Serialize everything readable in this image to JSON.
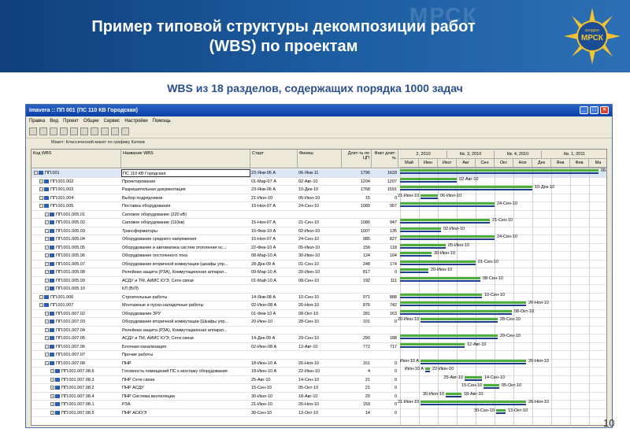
{
  "header": {
    "title_line1": "Пример типовой структуры декомпозиции работ",
    "title_line2": "(WBS) по проектам",
    "watermark": "МРСК",
    "logo_top": "холдинг",
    "logo_text": "МРСК"
  },
  "subtitle": "WBS из 18 разделов, содержащих порядка 1000 задач",
  "page_number": "10",
  "colors": {
    "header": "#1d5ea2",
    "bar_green": "#4caf3a",
    "bar_blue": "#1d3d8c"
  },
  "app": {
    "title": "Imavera :: ПП 001 (ПС 110 КВ Городская)",
    "menu": [
      "Правка",
      "Вид",
      "Проект",
      "Общие",
      "Сервис",
      "Настройки",
      "Помощь"
    ],
    "group_label": "Макет: Классический макет по графику Каткев",
    "columns": {
      "code": "Код WBS",
      "name": "Название WBS",
      "start": "Старт",
      "finish": "Финиш",
      "dur": "Длит-ть по ЦП",
      "fact": "Факт длит-ть"
    },
    "timeline_top": [
      "2, 2010",
      "Кв. 3, 2010",
      "Кв. 4, 2010",
      "Кв. 1, 2011"
    ],
    "timeline_months": [
      "Май",
      "Июн",
      "Июл",
      "Авг",
      "Сен",
      "Окт",
      "Ноя",
      "Дек",
      "Янв",
      "Фев",
      "Ма"
    ],
    "rows": [
      {
        "code": "ПП.001",
        "name": "ПС 110 КВ Городская",
        "start": "23-Янв-06 А",
        "finish": "06-Янв-11",
        "dur": "1796",
        "fact": "1633",
        "lvl": 0,
        "sel": true,
        "g": [
          0,
          252
        ],
        "lr": "06-Янв-11"
      },
      {
        "code": "ПП.001.002",
        "name": "Проектирование",
        "start": "01-Мар-07 А",
        "finish": "02-Авг-10",
        "dur": "1204",
        "fact": "1207",
        "lvl": 1,
        "g": [
          0,
          72
        ],
        "lr": "02-Авг-10"
      },
      {
        "code": "ПП.001.003",
        "name": "Разрешительная документация",
        "start": "23-Янв-06 А",
        "finish": "10-Дек-10",
        "dur": "1768",
        "fact": "1591",
        "lvl": 1,
        "g": [
          0,
          168
        ],
        "lr": "10-Дек-10"
      },
      {
        "code": "ПП.001.004",
        "name": "Выбор подрядчиков",
        "start": "21-Июн-10",
        "finish": "06-Июл-10",
        "dur": "15",
        "fact": "0",
        "lvl": 1,
        "g": [
          26,
          48
        ],
        "ll": "21-Июн-10",
        "lr": "06-Июл-10"
      },
      {
        "code": "ПП.001.005",
        "name": "Поставка оборудования",
        "start": "15-Ноя-07 А",
        "finish": "24-Сен-10",
        "dur": "1089",
        "fact": "957",
        "lvl": 1,
        "g": [
          0,
          120
        ],
        "lr": "24-Сен-10"
      },
      {
        "code": "ПП.001.005.01",
        "name": "Силовое оборудование (220 кВ)",
        "start": "",
        "finish": "",
        "dur": "",
        "fact": "",
        "lvl": 2
      },
      {
        "code": "ПП.001.005.02",
        "name": "Силовое оборудование (110кв)",
        "start": "15-Ноя-07 А",
        "finish": "21-Сен-10",
        "dur": "1086",
        "fact": "947",
        "lvl": 2,
        "g": [
          0,
          114
        ],
        "lr": "21-Сен-10"
      },
      {
        "code": "ПП.001.005.03",
        "name": "Трансформаторы",
        "start": "15-Фев-10 А",
        "finish": "02-Июл-10",
        "dur": "1007",
        "fact": "135",
        "lvl": 2,
        "g": [
          0,
          52
        ],
        "lr": "02-Июл-10"
      },
      {
        "code": "ПП.001.005.04",
        "name": "Оборудование среднего напряжения",
        "start": "15-Ноя-07 А",
        "finish": "24-Сен-10",
        "dur": "985",
        "fact": "827",
        "lvl": 2,
        "g": [
          0,
          120
        ],
        "lr": "24-Сен-10"
      },
      {
        "code": "ПП.001.005.05",
        "name": "Оборудование и автоматика систем отопления ос...",
        "start": "22-Фев-10 А",
        "finish": "05-Июл-10",
        "dur": "156",
        "fact": "118",
        "lvl": 2,
        "g": [
          0,
          58
        ],
        "lr": "05-Июл-10"
      },
      {
        "code": "ПП.001.005.06",
        "name": "Оборудование постоянного тока",
        "start": "08-Мар-10 А",
        "finish": "30-Июн-10",
        "dur": "124",
        "fact": "104",
        "lvl": 2,
        "g": [
          0,
          40
        ],
        "lr": "30-Июн-10"
      },
      {
        "code": "ПП.001.005.07",
        "name": "Оборудование вторичной коммутации (шкафы упр...",
        "start": "28-Дек-09 А",
        "finish": "01-Сен-10",
        "dur": "248",
        "fact": "174",
        "lvl": 2,
        "g": [
          0,
          96
        ],
        "lr": "01-Сен-10"
      },
      {
        "code": "ПП.001.005.08",
        "name": "Релейная защита (РЗА), Коммутационная аппарат...",
        "start": "09-Мар-10 А",
        "finish": "20-Июн-10",
        "dur": "817",
        "fact": "0",
        "lvl": 2,
        "g": [
          0,
          36
        ],
        "lr": "20-Июн-10"
      },
      {
        "code": "ПП.001.005.09",
        "name": "АСДУ и ТМ, АИИС КУЭ, Сети связи",
        "start": "01-Май-10 А",
        "finish": "08-Сен-10",
        "dur": "192",
        "fact": "111",
        "lvl": 2,
        "g": [
          0,
          102
        ],
        "lr": "08-Сен-10"
      },
      {
        "code": "ПП.001.005.10",
        "name": "КЛ (В/Л)",
        "start": "",
        "finish": "",
        "dur": "",
        "fact": "",
        "lvl": 2
      },
      {
        "code": "ПП.001.006",
        "name": "Строительные работы",
        "start": "14-Янв-08 А",
        "finish": "10-Сен-10",
        "dur": "971",
        "fact": "888",
        "lvl": 1,
        "g": [
          0,
          104
        ],
        "lr": "10-Сен-10"
      },
      {
        "code": "ПП.001.007",
        "name": "Монтажные и пуско-наладочные работы",
        "start": "02-Июн-08 А",
        "finish": "26-Ноя-10",
        "dur": "876",
        "fact": "742",
        "lvl": 1,
        "g": [
          0,
          160
        ],
        "lr": "26-Ноя-10"
      },
      {
        "code": "ПП.001.007.02",
        "name": "Оборудование ЗРУ",
        "start": "01-Фев-10 А",
        "finish": "08-Окт-10",
        "dur": "281",
        "fact": "163",
        "lvl": 2,
        "g": [
          0,
          142
        ],
        "lr": "08-Окт-10"
      },
      {
        "code": "ПП.001.007.03",
        "name": "Оборудование вторичной коммутации (Шкафы упр...",
        "start": "20-Июн-10",
        "finish": "28-Сен-10",
        "dur": "101",
        "fact": "0",
        "lvl": 2,
        "g": [
          26,
          124
        ],
        "ll": "20-Июн-10",
        "lr": "28-Сен-10"
      },
      {
        "code": "ПП.001.007.04",
        "name": "Релейная защита (РЗА), Коммутационная аппарат...",
        "start": "",
        "finish": "",
        "dur": "",
        "fact": "",
        "lvl": 2
      },
      {
        "code": "ПП.001.007.05",
        "name": "АСДУ и ТМ, АИИС КУЭ, Сети связи",
        "start": "14-Дек-09 А",
        "finish": "29-Сен-10",
        "dur": "290",
        "fact": "188",
        "lvl": 2,
        "g": [
          0,
          124
        ],
        "lr": "29-Сен-10"
      },
      {
        "code": "ПП.001.007.06",
        "name": "Блочная канализация",
        "start": "02-Июн-08 А",
        "finish": "12-Авг-10",
        "dur": "772",
        "fact": "717",
        "lvl": 2,
        "g": [
          0,
          82
        ],
        "lr": "12-Авг-10"
      },
      {
        "code": "ПП.001.007.07",
        "name": "Прочие работы",
        "start": "",
        "finish": "",
        "dur": "",
        "fact": "",
        "lvl": 2
      },
      {
        "code": "ПП.001.007.08",
        "name": "ПНР",
        "start": "18-Июн-10 А",
        "finish": "26-Ноя-10",
        "dur": "161",
        "fact": "0",
        "lvl": 2,
        "g": [
          26,
          160
        ],
        "ll": "Июн-10 А",
        "lr": "26-Ноя-10"
      },
      {
        "code": "ПП.001.007.08.6",
        "name": "Готовность помещений ПС к монтажу оборудования",
        "start": "18-Июн-10 А",
        "finish": "22-Июн-10",
        "dur": "4",
        "fact": "0",
        "lvl": 3,
        "g": [
          32,
          38
        ],
        "ll": "Июн-10 А",
        "lr": "22-Июн-10"
      },
      {
        "code": "ПП.001.007.08.3",
        "name": "ПНР Сети связи",
        "start": "25-Авг-10",
        "finish": "14-Сен-10",
        "dur": "21",
        "fact": "0",
        "lvl": 3,
        "g": [
          82,
          104
        ],
        "ll": "25-Авг-10",
        "lr": "14-Сен-10"
      },
      {
        "code": "ПП.001.007.08.2",
        "name": "ПНР АСДУ",
        "start": "15-Сен-10",
        "finish": "05-Окт-10",
        "dur": "21",
        "fact": "0",
        "lvl": 3,
        "g": [
          106,
          126
        ],
        "ll": "15-Сен-10",
        "lr": "05-Окт-10"
      },
      {
        "code": "ПП.001.007.08.4",
        "name": "ПНР Система вентиляции",
        "start": "30-Июл-10",
        "finish": "18-Авг-10",
        "dur": "20",
        "fact": "0",
        "lvl": 3,
        "g": [
          58,
          78
        ],
        "ll": "30-Июл-10",
        "lr": "18-Авг-10"
      },
      {
        "code": "ПП.001.007.08.1",
        "name": "РЗА",
        "start": "21-Июн-10",
        "finish": "26-Ноя-10",
        "dur": "159",
        "fact": "0",
        "lvl": 3,
        "g": [
          26,
          160
        ],
        "ll": "21-Июн-10",
        "lr": "26-Ноя-10"
      },
      {
        "code": "ПП.001.007.08.5",
        "name": "ПНР АСКУЭ",
        "start": "30-Сен-10",
        "finish": "13-Окт-10",
        "dur": "14",
        "fact": "0",
        "lvl": 3,
        "g": [
          122,
          134
        ],
        "ll": "30-Сен-10",
        "lr": "13-Окт-10"
      }
    ]
  }
}
